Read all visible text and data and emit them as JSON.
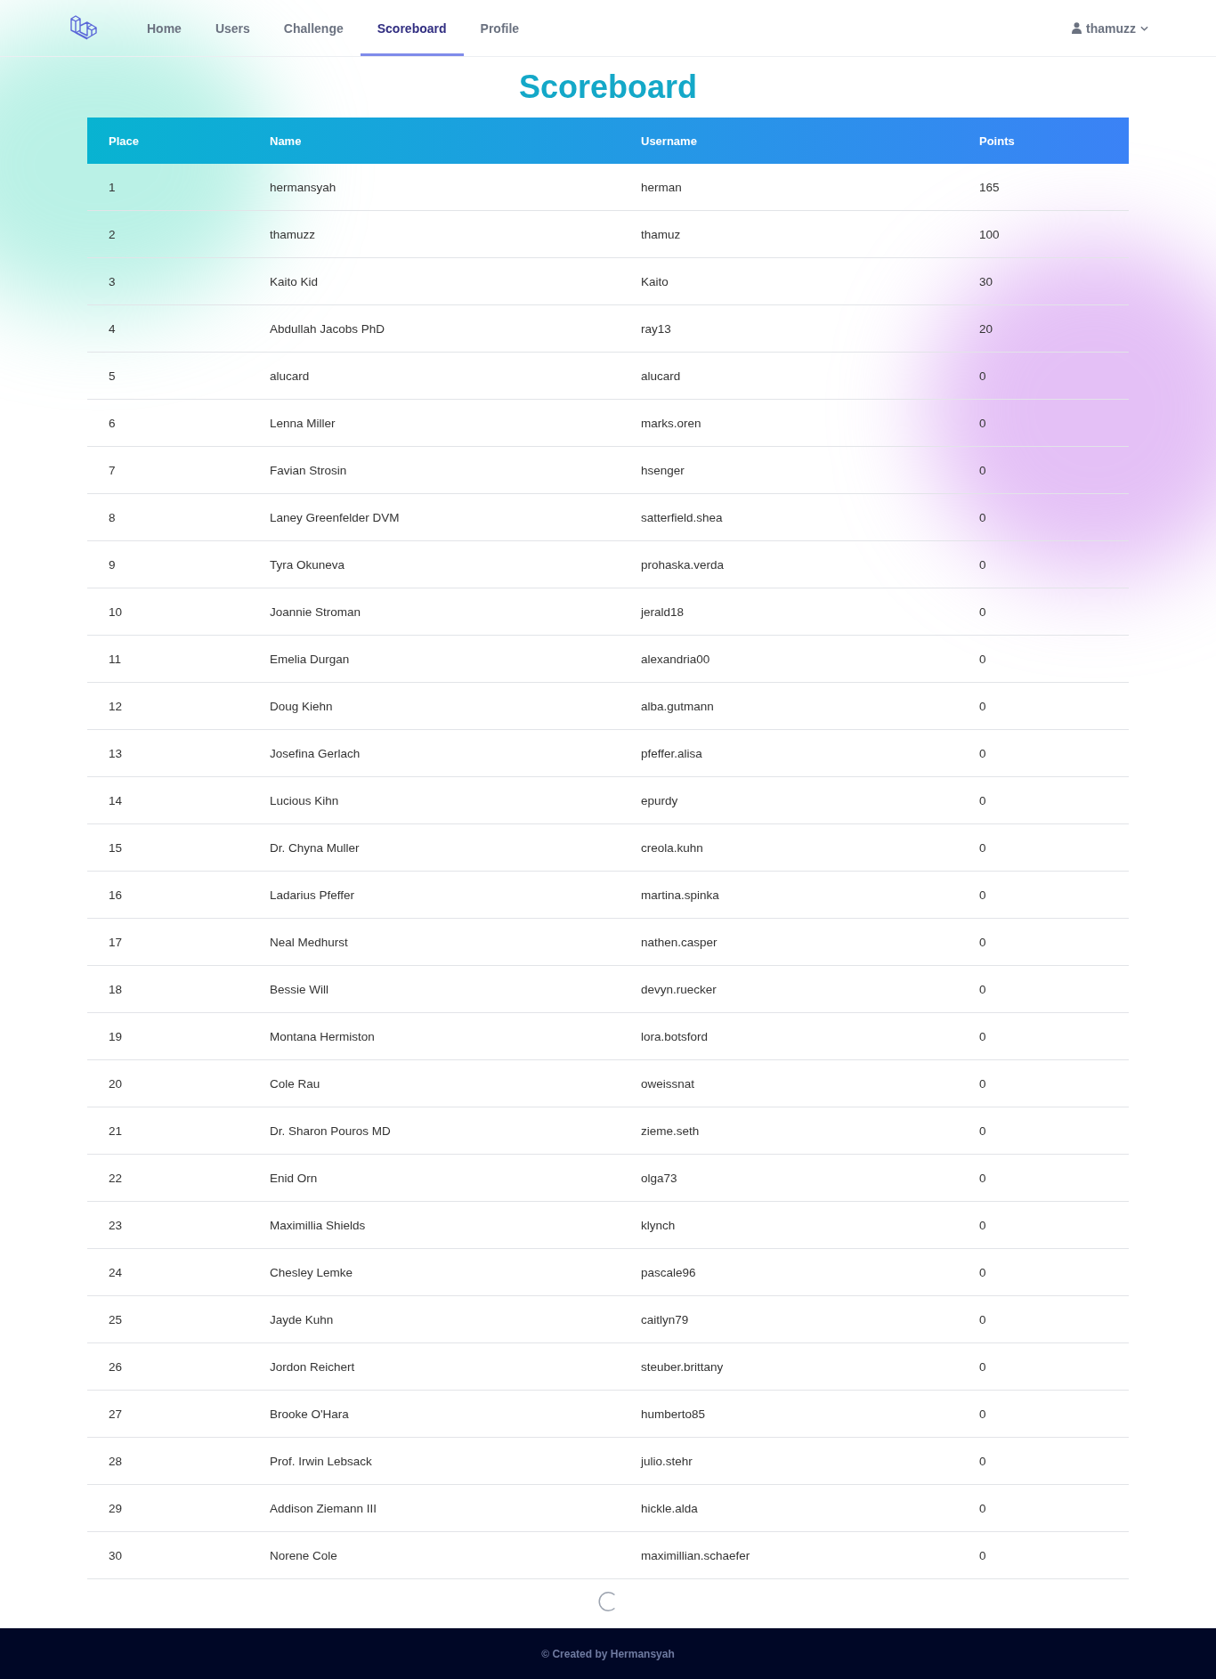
{
  "nav": {
    "items": [
      {
        "label": "Home",
        "selected": false
      },
      {
        "label": "Users",
        "selected": false
      },
      {
        "label": "Challenge",
        "selected": false
      },
      {
        "label": "Scoreboard",
        "selected": true
      },
      {
        "label": "Profile",
        "selected": false
      }
    ],
    "user": {
      "name": "thamuzz"
    }
  },
  "title": "Scoreboard",
  "table": {
    "columns": [
      "Place",
      "Name",
      "Username",
      "Points"
    ],
    "rows": [
      [
        "1",
        "hermansyah",
        "herman",
        "165"
      ],
      [
        "2",
        "thamuzz",
        "thamuz",
        "100"
      ],
      [
        "3",
        "Kaito Kid",
        "Kaito",
        "30"
      ],
      [
        "4",
        "Abdullah Jacobs PhD",
        "ray13",
        "20"
      ],
      [
        "5",
        "alucard",
        "alucard",
        "0"
      ],
      [
        "6",
        "Lenna Miller",
        "marks.oren",
        "0"
      ],
      [
        "7",
        "Favian Strosin",
        "hsenger",
        "0"
      ],
      [
        "8",
        "Laney Greenfelder DVM",
        "satterfield.shea",
        "0"
      ],
      [
        "9",
        "Tyra Okuneva",
        "prohaska.verda",
        "0"
      ],
      [
        "10",
        "Joannie Stroman",
        "jerald18",
        "0"
      ],
      [
        "11",
        "Emelia Durgan",
        "alexandria00",
        "0"
      ],
      [
        "12",
        "Doug Kiehn",
        "alba.gutmann",
        "0"
      ],
      [
        "13",
        "Josefina Gerlach",
        "pfeffer.alisa",
        "0"
      ],
      [
        "14",
        "Lucious Kihn",
        "epurdy",
        "0"
      ],
      [
        "15",
        "Dr. Chyna Muller",
        "creola.kuhn",
        "0"
      ],
      [
        "16",
        "Ladarius Pfeffer",
        "martina.spinka",
        "0"
      ],
      [
        "17",
        "Neal Medhurst",
        "nathen.casper",
        "0"
      ],
      [
        "18",
        "Bessie Will",
        "devyn.ruecker",
        "0"
      ],
      [
        "19",
        "Montana Hermiston",
        "lora.botsford",
        "0"
      ],
      [
        "20",
        "Cole Rau",
        "oweissnat",
        "0"
      ],
      [
        "21",
        "Dr. Sharon Pouros MD",
        "zieme.seth",
        "0"
      ],
      [
        "22",
        "Enid Orn",
        "olga73",
        "0"
      ],
      [
        "23",
        "Maximillia Shields",
        "klynch",
        "0"
      ],
      [
        "24",
        "Chesley Lemke",
        "pascale96",
        "0"
      ],
      [
        "25",
        "Jayde Kuhn",
        "caitlyn79",
        "0"
      ],
      [
        "26",
        "Jordon Reichert",
        "steuber.brittany",
        "0"
      ],
      [
        "27",
        "Brooke O'Hara",
        "humberto85",
        "0"
      ],
      [
        "28",
        "Prof. Irwin Lebsack",
        "julio.stehr",
        "0"
      ],
      [
        "29",
        "Addison Ziemann III",
        "hickle.alda",
        "0"
      ],
      [
        "30",
        "Norene Cole",
        "maximillian.schaefer",
        "0"
      ]
    ]
  },
  "footer": "© Created by Hermansyah"
}
